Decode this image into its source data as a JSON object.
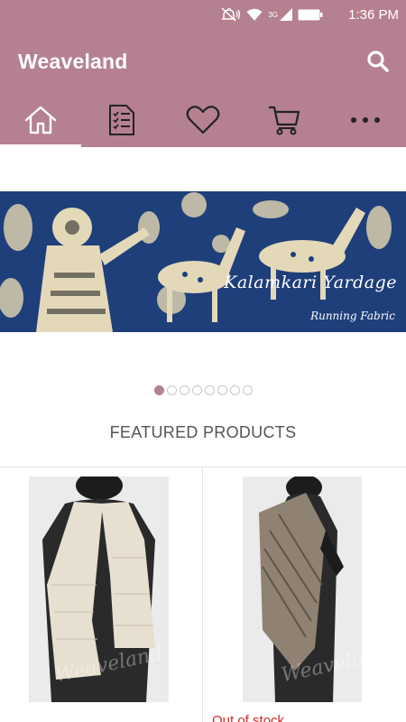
{
  "status_bar": {
    "time": "1:36 PM",
    "network_label": "3G",
    "icons": [
      "mute-icon",
      "wifi-icon",
      "signal-icon",
      "battery-icon"
    ]
  },
  "header": {
    "title": "Weaveland",
    "search_icon": "search-icon"
  },
  "tabs": [
    {
      "icon": "home-icon",
      "active": true
    },
    {
      "icon": "checklist-icon",
      "active": false
    },
    {
      "icon": "heart-icon",
      "active": false
    },
    {
      "icon": "cart-icon",
      "active": false
    },
    {
      "icon": "more-icon",
      "active": false
    }
  ],
  "banner": {
    "title": "Kalamkari Yardage",
    "subtitle": "Running Fabric",
    "slide_count": 8,
    "active_slide": 1
  },
  "featured": {
    "title": "FEATURED PRODUCTS",
    "products": [
      {
        "image_icon": "scarf-image",
        "watermark": "Weaveland",
        "stock_status": ""
      },
      {
        "image_icon": "shawl-image",
        "watermark": "Weaveland",
        "stock_status": "Out of stock"
      }
    ]
  },
  "colors": {
    "accent": "#b5808f",
    "out_of_stock": "#d22a2a",
    "banner_blue": "#1f3f7a"
  }
}
